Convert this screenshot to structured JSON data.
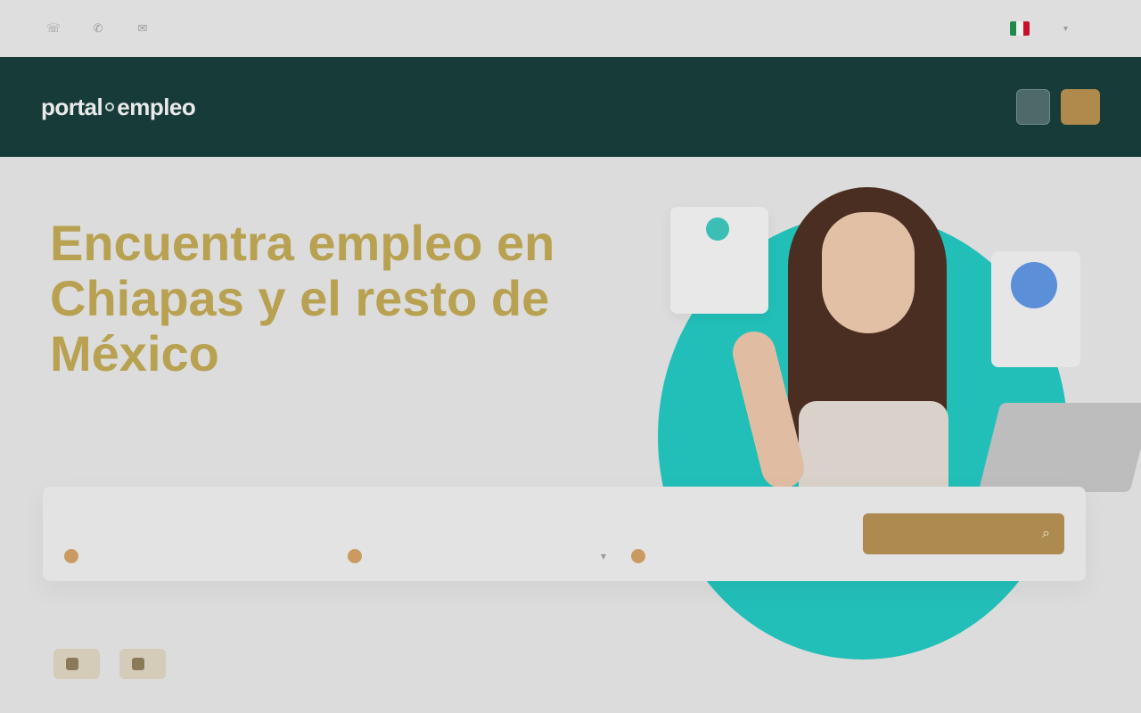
{
  "topbar": {
    "phone": "",
    "whatsapp": "",
    "email": "",
    "language": "",
    "flag_colors": [
      "#1e8a4c",
      "#eeeeee",
      "#c8102e"
    ]
  },
  "nav": {
    "logo_left": "portal",
    "logo_right": "empleo",
    "links": [
      "",
      "",
      "",
      ""
    ],
    "login_label": "",
    "cta_label": ""
  },
  "hero": {
    "title": "Encuentra empleo en Chiapas y el resto de México",
    "description": ""
  },
  "image_cards": {
    "stat_lines": "",
    "badge_number": "",
    "badge_sub": ""
  },
  "search": {
    "field1_label": "",
    "field1_placeholder": "",
    "field2_label": "",
    "field2_placeholder": "",
    "field3_label": "",
    "field3_placeholder": "",
    "button_label": ""
  },
  "recent": {
    "prefix": "",
    "location": "",
    "chips": [
      "",
      ""
    ]
  },
  "colors": {
    "nav_bg": "#173b38",
    "accent_gold": "#b08a4c",
    "title_gold": "#b9a152",
    "teal": "#22bfb8"
  }
}
